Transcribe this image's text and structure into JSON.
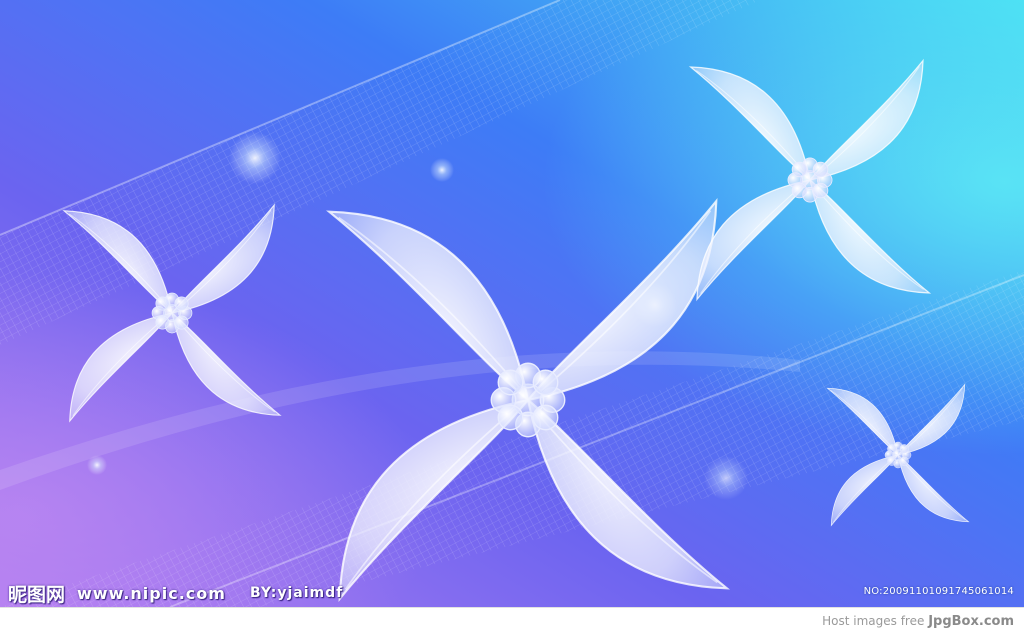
{
  "image": {
    "subject": "flower-wallpaper",
    "colors": {
      "bg_left": "#a36ef0",
      "bg_mid": "#4a6cf5",
      "bg_right": "#44d3f3",
      "petal": "#f2f6ff"
    }
  },
  "watermark": {
    "logo": "昵图网",
    "url": "www.nipic.com",
    "author": "BY:yjaimdf",
    "serial": "NO:20091101091745061014"
  },
  "footer": {
    "prefix": "Host images free",
    "brand": "JpgBox.com"
  }
}
